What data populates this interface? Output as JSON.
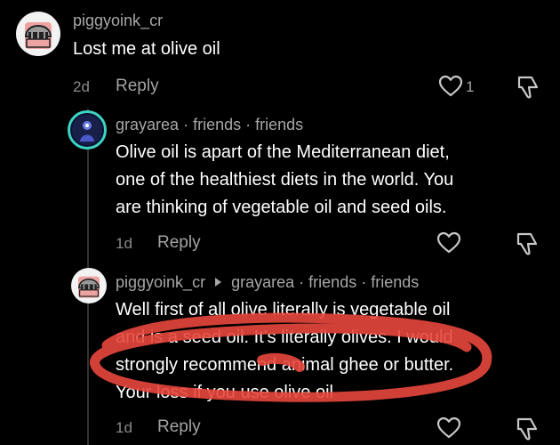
{
  "comment1": {
    "username": "piggyoink_cr",
    "text": "Lost me at olive oil",
    "age": "2d",
    "reply_label": "Reply",
    "like_count": "1"
  },
  "comment2": {
    "username": "grayarea",
    "tag1": "friends",
    "tag2": "friends",
    "lines": [
      "Olive oil is apart of the Mediterranean diet,",
      "one of the healthiest diets in the world. You",
      "are thinking of vegetable oil and seed oils."
    ],
    "age": "1d",
    "reply_label": "Reply"
  },
  "comment3": {
    "username": "piggyoink_cr",
    "reply_to": "grayarea",
    "tag1": "friends",
    "tag2": "friends",
    "lines": [
      "Well first of all olive literally is vegetable oil",
      "and is a seed oil. It's literally olives. I would",
      "strongly recommend animal ghee or butter.",
      "Your loss if you use olive oil"
    ],
    "age": "1d",
    "reply_label": "Reply"
  },
  "separator": "·",
  "icons": {
    "like": "heart-icon",
    "dislike": "thumbs-down-icon",
    "reply_arrow": "caret-right-icon"
  },
  "colors": {
    "background": "#000000",
    "text": "#ffffff",
    "muted": "#a6a6a6",
    "highlight": "#e8473c"
  }
}
